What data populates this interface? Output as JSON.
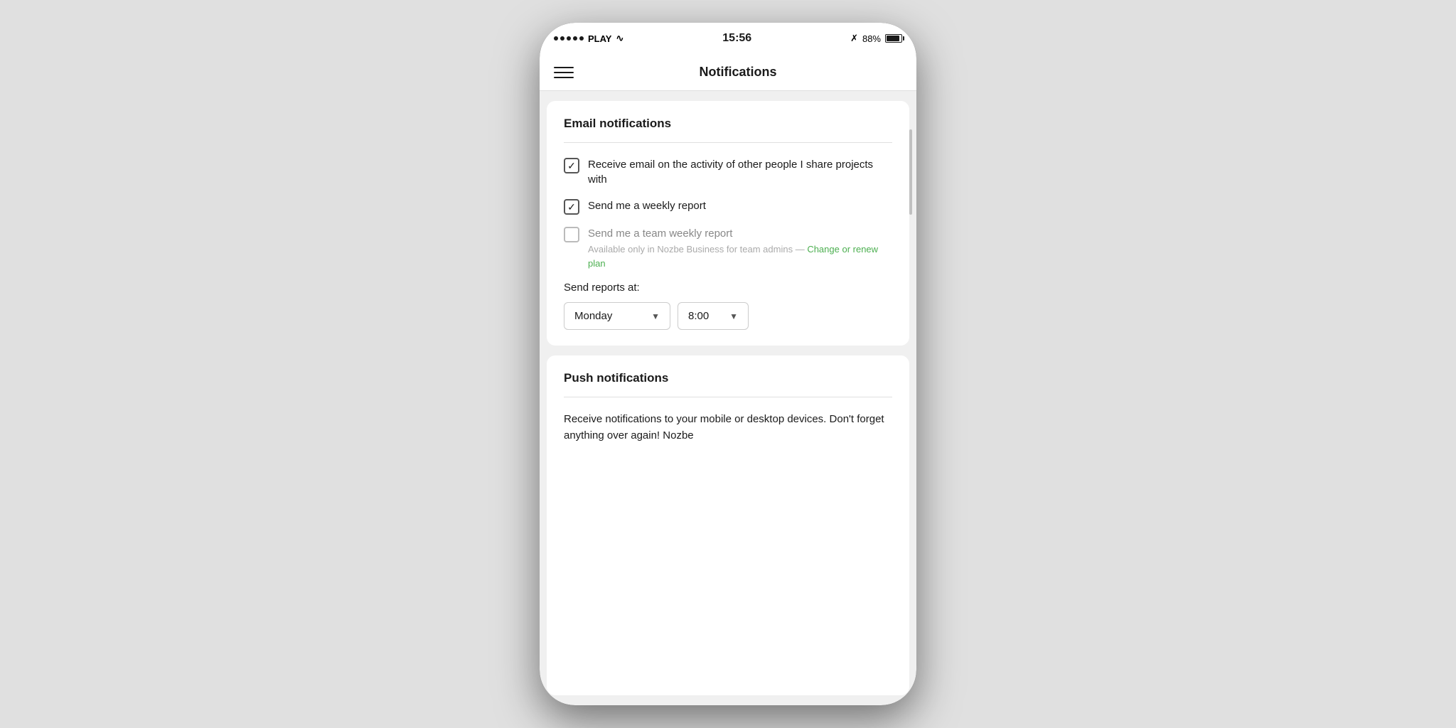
{
  "statusBar": {
    "carrier": "PLAY",
    "time": "15:56",
    "battery": "88%"
  },
  "navBar": {
    "title": "Notifications"
  },
  "emailSection": {
    "title": "Email notifications",
    "checkbox1": {
      "label": "Receive email on the activity of other people I share projects with",
      "checked": true
    },
    "checkbox2": {
      "label": "Send me a weekly report",
      "checked": true
    },
    "checkbox3": {
      "label": "Send me a team weekly report",
      "checked": false,
      "disabled": true,
      "note": "Available only in Nozbe Business for team admins —",
      "changePlan": "Change or renew plan"
    },
    "sendReports": {
      "label": "Send reports at:",
      "dayValue": "Monday",
      "timeValue": "8:00"
    }
  },
  "pushSection": {
    "title": "Push notifications",
    "description": "Receive notifications to your mobile or desktop devices. Don't forget anything over again! Nozbe"
  }
}
